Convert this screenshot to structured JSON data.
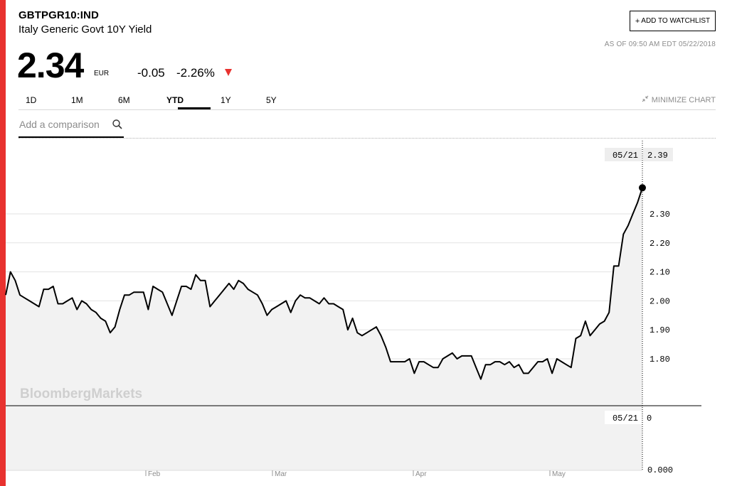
{
  "header": {
    "ticker": "GBTPGR10:IND",
    "name": "Italy Generic Govt 10Y Yield",
    "price": "2.34",
    "currency": "EUR",
    "change": "-0.05",
    "change_pct": "-2.26%",
    "as_of": "AS OF 09:50 AM EDT 05/22/2018"
  },
  "buttons": {
    "watchlist_plus": "+",
    "watchlist_label": "ADD TO WATCHLIST",
    "minimize_label": "MINIMIZE CHART",
    "minimize_icon": "minimize-arrows-icon"
  },
  "tabs": [
    {
      "label": "1D"
    },
    {
      "label": "1M"
    },
    {
      "label": "6M"
    },
    {
      "label": "YTD",
      "active": true
    },
    {
      "label": "1Y"
    },
    {
      "label": "5Y"
    }
  ],
  "comparison": {
    "placeholder": "Add a comparison"
  },
  "colors": {
    "accent": "#e8322f",
    "negative": "#e8322f",
    "line": "#000000",
    "area": "#f2f2f2",
    "muted": "#8c8c8c"
  },
  "chart_data": {
    "type": "area",
    "watermark": "BloombergMarkets",
    "x_labels": [
      "Feb",
      "Mar",
      "Apr",
      "May"
    ],
    "y_ticks": [
      "1.80",
      "1.90",
      "2.00",
      "2.10",
      "2.20",
      "2.30"
    ],
    "ylim": [
      1.68,
      2.49
    ],
    "series": [
      {
        "values": [
          2.02,
          2.1,
          2.07,
          2.02,
          2.01,
          2.0,
          1.99,
          1.98,
          2.04,
          2.04,
          2.05,
          1.99,
          1.99,
          2.0,
          2.01,
          1.97,
          2.0,
          1.99,
          1.97,
          1.96,
          1.94,
          1.93,
          1.89,
          1.91,
          1.97,
          2.02,
          2.02,
          2.03,
          2.03,
          2.03,
          1.97,
          2.05,
          2.04,
          2.03,
          1.99,
          1.95,
          2.0,
          2.05,
          2.05,
          2.04,
          2.09,
          2.07,
          2.07,
          1.98,
          2.0,
          2.02,
          2.04,
          2.06,
          2.04,
          2.07,
          2.06,
          2.04,
          2.03,
          2.02,
          1.99,
          1.95,
          1.97,
          1.98,
          1.99,
          2.0,
          1.96,
          2.0,
          2.02,
          2.01,
          2.01,
          2.0,
          1.99,
          2.01,
          1.99,
          1.99,
          1.98,
          1.97,
          1.9,
          1.94,
          1.89,
          1.88,
          1.89,
          1.9,
          1.91,
          1.88,
          1.84,
          1.79,
          1.79,
          1.79,
          1.79,
          1.8,
          1.75,
          1.79,
          1.79,
          1.78,
          1.77,
          1.77,
          1.8,
          1.81,
          1.82,
          1.8,
          1.81,
          1.81,
          1.81,
          1.77,
          1.73,
          1.78,
          1.78,
          1.79,
          1.79,
          1.78,
          1.79,
          1.77,
          1.78,
          1.75,
          1.75,
          1.77,
          1.79,
          1.79,
          1.8,
          1.75,
          1.8,
          1.79,
          1.78,
          1.77,
          1.87,
          1.88,
          1.93,
          1.88,
          1.9,
          1.92,
          1.93,
          1.96,
          2.12,
          2.12,
          2.23,
          2.26,
          2.3,
          2.34,
          2.39
        ]
      }
    ],
    "crosshair": {
      "date": "05/21",
      "value": "2.39"
    },
    "volume_panel": {
      "date": "05/21",
      "value": "0",
      "axis_label": "0.000"
    }
  }
}
